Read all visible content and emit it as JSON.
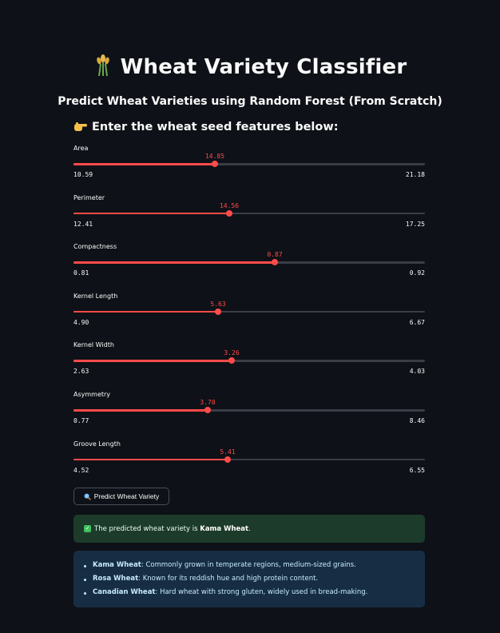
{
  "header": {
    "title": "Wheat Variety Classifier",
    "title_icon": "sheaf-of-rice-emoji",
    "subtitle": "Predict Wheat Varieties using Random Forest (From Scratch)"
  },
  "form": {
    "prompt_icon": "pointing-hand-emoji",
    "prompt": "Enter the wheat seed features below:",
    "sliders": [
      {
        "label": "Area",
        "value": "14.85",
        "min": "10.59",
        "max": "21.18",
        "fraction": 0.402
      },
      {
        "label": "Perimeter",
        "value": "14.56",
        "min": "12.41",
        "max": "17.25",
        "fraction": 0.444
      },
      {
        "label": "Compactness",
        "value": "0.87",
        "min": "0.81",
        "max": "0.92",
        "fraction": 0.573
      },
      {
        "label": "Kernel Length",
        "value": "5.63",
        "min": "4.90",
        "max": "6.67",
        "fraction": 0.412
      },
      {
        "label": "Kernel Width",
        "value": "3.26",
        "min": "2.63",
        "max": "4.03",
        "fraction": 0.45
      },
      {
        "label": "Asymmetry",
        "value": "3.70",
        "min": "0.77",
        "max": "8.46",
        "fraction": 0.381
      },
      {
        "label": "Groove Length",
        "value": "5.41",
        "min": "4.52",
        "max": "6.55",
        "fraction": 0.438
      }
    ],
    "button_label": "Predict Wheat Variety",
    "button_icon": "magnifier-icon"
  },
  "result": {
    "icon": "check-icon",
    "prefix": "The predicted wheat variety is ",
    "variety": "Kama Wheat",
    "suffix": "."
  },
  "info": {
    "items": [
      {
        "name": "Kama Wheat",
        "desc": ": Commonly grown in temperate regions, medium-sized grains."
      },
      {
        "name": "Rosa Wheat",
        "desc": ": Known for its reddish hue and high protein content."
      },
      {
        "name": "Canadian Wheat",
        "desc": ": Hard wheat with strong gluten, widely used in bread-making."
      }
    ]
  },
  "colors": {
    "background": "#0e1117",
    "accent": "#ff4b4b",
    "success_bg": "#1d3b2a",
    "info_bg": "#172d43"
  }
}
